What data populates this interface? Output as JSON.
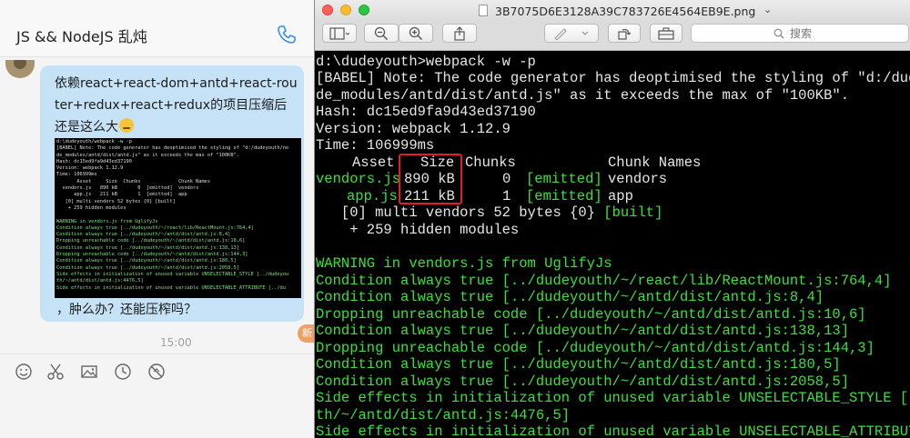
{
  "chat": {
    "title": "JS && NodeJS 乱炖",
    "message_text": "依赖react+react-dom+antd+react-router+redux+react+redux的项目压缩后还是这么大",
    "message_caption": "，肿么办？还能压榨吗？",
    "timestamp": "15:00",
    "new_badge": "新",
    "thumbnail_lines": [
      "d:\\dudeyouth/webpack -w -p",
      "[BABEL] Note: The code generator has deoptimised the styling of \"d:/dudeyouth/no",
      "de_modules/antd/dist/antd.js\" as it exceeds the max of \"100KB\".",
      "Hash: dc15ed9fa9d43ed37190",
      "Version: webpack 1.12.9",
      "Time: 106999ms",
      "       Asset     Size  Chunks             Chunk Names",
      "  vendors.js   890 kB       0  [emitted]  vendors",
      "      app.js   211 kB       1  [emitted]  app",
      "   [0] multi vendors 52 bytes {0} [built]",
      "    + 259 hidden modules",
      "",
      "WARNING in vendors.js from UglifyJs",
      "Condition always true [../dudeyouth/~/react/lib/ReactMount.js:764,4]",
      "Condition always true [../dudeyouth/~/antd/dist/antd.js:8,4]",
      "Dropping unreachable code [../dudeyouth/~/antd/dist/antd.js:10,6]",
      "Condition always true [../dudeyouth/~/antd/dist/antd.js:138,13]",
      "Dropping unreachable code [../dudeyouth/~/antd/dist/antd.js:144,3]",
      "Condition always true [../dudeyouth/~/antd/dist/antd.js:180,5]",
      "Condition always true [../dudeyouth/~/antd/dist/antd.js:2058,5]",
      "Side effects in initialization of unused variable UNSELECTABLE_STYLE [../dudeyou",
      "th/~/antd/dist/antd.js:4476,5]",
      "Side effects in initialization of unused variable UNSELECTABLE_ATTRIBUTE [../du"
    ],
    "toolbar_icons": [
      "emoji-icon",
      "scissors-icon",
      "image-icon",
      "clock-icon",
      "shake-icon"
    ]
  },
  "preview": {
    "window_title": "3B7075D6E3128A39C783726E4564EB9E.png",
    "title_chevron": "⌄",
    "search_placeholder": "搜索",
    "terminal": {
      "command": "d:\\dudeyouth>webpack -w -p",
      "babel_note_1": "[BABEL] Note: The code generator has deoptimised the styling of \"d:/dudeyouth/n",
      "babel_note_2": "de_modules/antd/dist/antd.js\" as it exceeds the max of \"100KB\".",
      "hash": "Hash: dc15ed9fa9d43ed37190",
      "version": "Version: webpack 1.12.9",
      "time": "Time: 106999ms",
      "headers": {
        "asset": "Asset",
        "size": "Size",
        "chunks": "Chunks",
        "chunk_names": "Chunk Names"
      },
      "assets": [
        {
          "asset": "vendors.js",
          "size": "890 kB",
          "chunks": "0",
          "status": "[emitted]",
          "name": "vendors"
        },
        {
          "asset": "app.js",
          "size": "211 kB",
          "chunks": "1",
          "status": "[emitted]",
          "name": "app"
        }
      ],
      "multi_prefix": "   [0] multi vendors 52 bytes {0} ",
      "multi_built": "[built]",
      "hidden_modules": "    + 259 hidden modules",
      "warnings": [
        "WARNING in vendors.js from UglifyJs",
        "Condition always true [../dudeyouth/~/react/lib/ReactMount.js:764,4]",
        "Condition always true [../dudeyouth/~/antd/dist/antd.js:8,4]",
        "Dropping unreachable code [../dudeyouth/~/antd/dist/antd.js:10,6]",
        "Condition always true [../dudeyouth/~/antd/dist/antd.js:138,13]",
        "Dropping unreachable code [../dudeyouth/~/antd/dist/antd.js:144,3]",
        "Condition always true [../dudeyouth/~/antd/dist/antd.js:180,5]",
        "Condition always true [../dudeyouth/~/antd/dist/antd.js:2058,5]",
        "Side effects in initialization of unused variable UNSELECTABLE_STYLE [../dudeyo",
        "th/~/antd/dist/antd.js:4476,5]",
        "Side effects in initialization of unused variable UNSELECTABLE_ATTRIBUTE [../du"
      ],
      "highlight_color": "#e02020",
      "text_color": "#e6e6e6",
      "green_color": "#3ce03c"
    }
  }
}
